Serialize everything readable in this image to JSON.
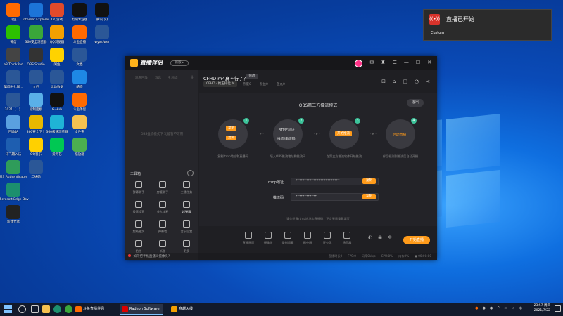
{
  "desktop": {
    "icons": [
      {
        "label": "斗鱼",
        "color": "#ff6a00"
      },
      {
        "label": "微信",
        "color": "#2dc100"
      },
      {
        "label": "e3 ThinkPad",
        "color": "#444"
      },
      {
        "label": "第四十七届...",
        "color": "#2b5797"
      },
      {
        "label": "2021（...）",
        "color": "#2b5797"
      },
      {
        "label": "回收站",
        "color": "#5aa0e0"
      },
      {
        "label": "讯飞输入法",
        "color": "#1e5eb0"
      },
      {
        "label": "MS Authenticator",
        "color": "#2f9c5a"
      },
      {
        "label": "Microsoft Edge Dev",
        "color": "#1c8f6e"
      },
      {
        "label": "新建文本",
        "color": "#222"
      },
      {
        "label": "Internet Explorer",
        "color": "#1c74d8"
      },
      {
        "label": "360安全浏览器",
        "color": "#3aa63a"
      },
      {
        "label": "OBS Studio",
        "color": "#333"
      },
      {
        "label": "文档",
        "color": "#2b5797"
      },
      {
        "label": "控制面板",
        "color": "#5ab0e8"
      },
      {
        "label": "360安全卫士",
        "color": "#e8b800"
      },
      {
        "label": "QQ音乐",
        "color": "#ffd000"
      },
      {
        "label": "二维码",
        "color": "#2b5797"
      },
      {
        "label": "QQ游戏",
        "color": "#e24a2a"
      },
      {
        "label": "QQ浏览器",
        "color": "#f4a000"
      },
      {
        "label": "闲鱼",
        "color": "#ffd200"
      },
      {
        "label": "运动数据",
        "color": "#2b5797"
      },
      {
        "label": "G-Hub",
        "color": "#111"
      },
      {
        "label": "360极速浏览器",
        "color": "#1fb3d6"
      },
      {
        "label": "爱奇艺",
        "color": "#00c853"
      },
      {
        "label": "剪映专业版",
        "color": "#111"
      },
      {
        "label": "斗鱼直播",
        "color": "#ff6a00"
      },
      {
        "label": "文档",
        "color": "#2b5797"
      },
      {
        "label": "酷狗",
        "color": "#1e88e5"
      },
      {
        "label": "斗鱼伴侣",
        "color": "#ff6a00"
      },
      {
        "label": "文件夹",
        "color": "#f4c150"
      },
      {
        "label": "播放器",
        "color": "#4caf50"
      },
      {
        "label": "腾讯QQ",
        "color": "#111"
      },
      {
        "label": "wyxsfwer",
        "color": "#2b5797"
      }
    ]
  },
  "window": {
    "app_name": "直播伴侣",
    "version_badge": "新版 ▸",
    "side_tabs": [
      "观看回放",
      "消息",
      "礼物墙"
    ],
    "side_empty": "OBS推流模式下 功能暂不可用",
    "tools_title": "工具箱",
    "tools": [
      {
        "label": "弹幕助手"
      },
      {
        "label": "房管助手"
      },
      {
        "label": "主播任务"
      },
      {
        "label": "投票设置"
      },
      {
        "label": "多人连麦"
      },
      {
        "label": "超弹幕"
      },
      {
        "label": "超级抽奖"
      },
      {
        "label": "弹幕墙"
      },
      {
        "label": "音乐设置"
      },
      {
        "label": "拍档"
      },
      {
        "label": "新游"
      },
      {
        "label": "更多"
      }
    ],
    "footer_tip": "如何把手机直播间摄像头?",
    "room": {
      "title": "CFHD m4真不行了？",
      "tag": "修改",
      "category": "CFHD · 枪王排位 ✎",
      "stats": [
        "热度0",
        "粉丝0",
        "鱼丸0"
      ]
    },
    "mode_title": "OBS第三方推流模式",
    "exit_label": "退出",
    "steps": [
      {
        "num": "1",
        "text": "复制",
        "desc": "复制rtmp地址和直播码"
      },
      {
        "num": "2",
        "text": "RTMP地址",
        "desc": "填入OBS推流地址和推流码"
      },
      {
        "num": "3",
        "text": "开始推流",
        "desc": "在第三方推流软件开始推流"
      },
      {
        "num": "4",
        "text": "启动直播",
        "desc": "伴侣检测到推流后自动开播"
      }
    ],
    "step2_sub": "推流/串流码",
    "fields": [
      {
        "label": "rtmp地址",
        "value": "*************************",
        "button": "复制"
      },
      {
        "label": "推流码",
        "value": "************",
        "button": "复制"
      }
    ],
    "hint": "请勿泄露rtmp地址和直播码，下次无需重复填写",
    "bottom_tools": [
      "直播画面",
      "摄像头",
      "录制屏幕",
      "画中画",
      "麦克风",
      "扬声器"
    ],
    "go_live": "开始直播",
    "status": [
      "直播时长0",
      "FPS:0",
      "码率0kb/s",
      "CPU:0%",
      "内存0%",
      "● 00:00:00"
    ]
  },
  "toast": {
    "title": "直播已开始",
    "body": "Custom"
  },
  "taskbar": {
    "apps": [
      {
        "label": "斗鱼直播伴侣",
        "color": "#ff6a00"
      },
      {
        "label": "Radeon Software",
        "color": "#d00"
      },
      {
        "label": "穿越火线",
        "color": "#f4a000"
      }
    ],
    "clock_time": "23:57 周四",
    "clock_date": "2021/7/22"
  }
}
